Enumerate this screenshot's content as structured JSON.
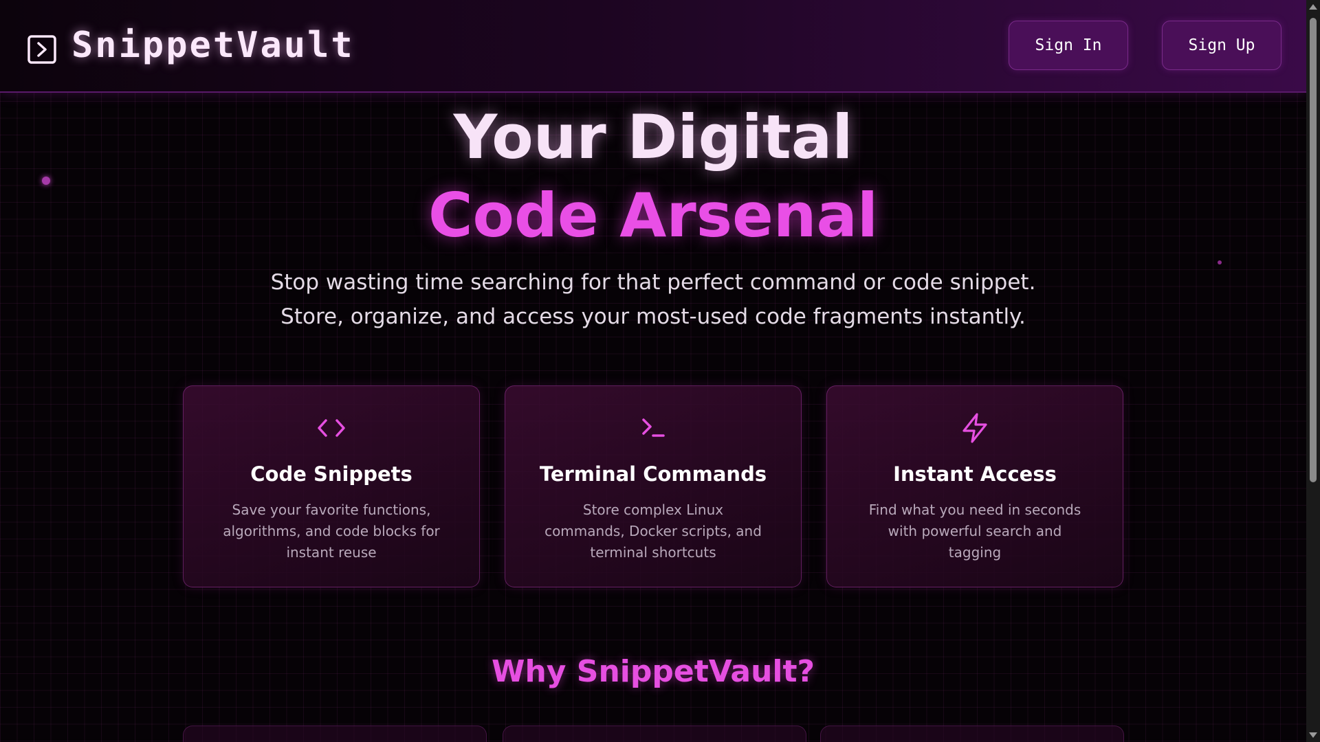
{
  "header": {
    "logo_icon": "terminal-chevron-icon",
    "brand": "SnippetVault",
    "sign_in": "Sign In",
    "sign_up": "Sign Up"
  },
  "hero": {
    "line1": "Your Digital",
    "line2": "Code Arsenal",
    "subtitle_line1": "Stop wasting time searching for that perfect command or code snippet.",
    "subtitle_line2": "Store, organize, and access your most-used code fragments instantly."
  },
  "features": [
    {
      "icon": "code-brackets-icon",
      "title": "Code Snippets",
      "description": "Save your favorite functions, algorithms, and code blocks for instant reuse"
    },
    {
      "icon": "terminal-prompt-icon",
      "title": "Terminal Commands",
      "description": "Store complex Linux commands, Docker scripts, and terminal shortcuts"
    },
    {
      "icon": "lightning-bolt-icon",
      "title": "Instant Access",
      "description": "Find what you need in seconds with powerful search and tagging"
    }
  ],
  "why_section": {
    "heading": "Why SnippetVault?"
  },
  "colors": {
    "accent_pink": "#e94fe6",
    "header_button_bg": "#4a0f58",
    "background": "#060206"
  }
}
